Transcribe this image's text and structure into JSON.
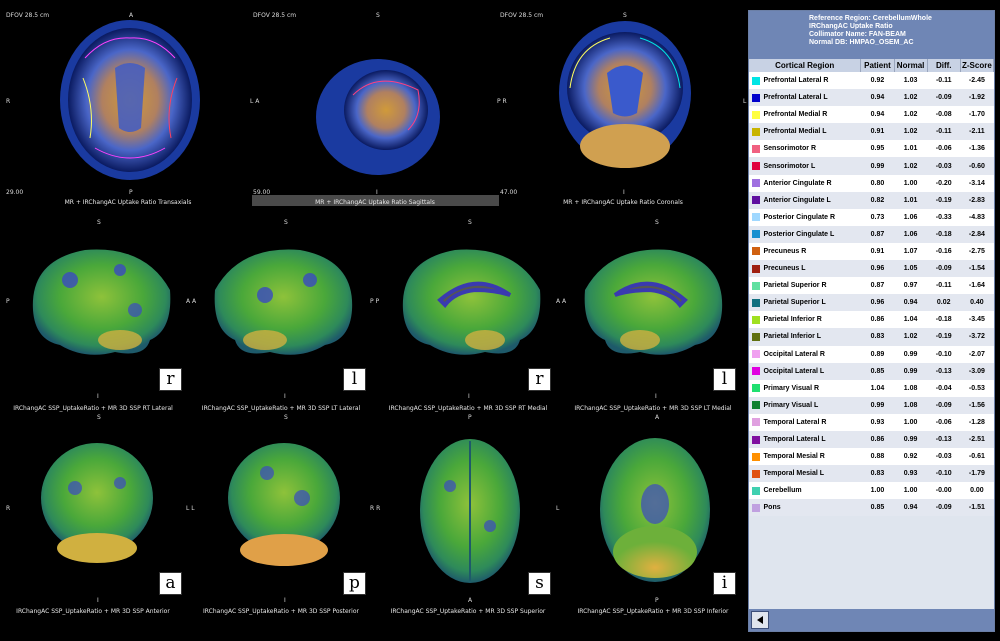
{
  "top": {
    "dfov_1": "DFOV 28.5 cm",
    "dfov_2": "DFOV 28.5 cm",
    "dfov_3": "DFOV 28.5 cm",
    "orient_1_top": "A",
    "orient_1_left": "R",
    "orient_1_bottom": "P",
    "orient_1_num": "29.00",
    "orient_2_top": "S",
    "orient_2_left": "L A",
    "orient_2_bottom": "I",
    "orient_2_num": "59.00",
    "orient_3_top": "S",
    "orient_3_left": "P R",
    "orient_3_right": "L",
    "orient_3_bottom": "I",
    "orient_3_num": "47.00",
    "caption_1": "MR + IRChangAC Uptake Ratio Transaxials",
    "caption_2": "MR + IRChangAC Uptake Ratio Sagittals",
    "caption_3": "MR + IRChangAC Uptake Ratio Coronals"
  },
  "mid": {
    "tops": [
      "S",
      "S",
      "S",
      "S"
    ],
    "lefts": [
      "P",
      "A A",
      "P P",
      "A A"
    ],
    "bottoms": [
      "I",
      "I",
      "I",
      "I"
    ],
    "badges": [
      "r",
      "l",
      "r",
      "l"
    ],
    "captions": [
      "IRChangAC SSP_UptakeRatio + MR 3D SSP RT Lateral",
      "IRChangAC SSP_UptakeRatio + MR 3D SSP LT Lateral",
      "IRChangAC SSP_UptakeRatio + MR 3D SSP RT Medial",
      "IRChangAC SSP_UptakeRatio + MR 3D SSP LT Medial"
    ]
  },
  "bot": {
    "tops": [
      "S",
      "S",
      "P",
      "A"
    ],
    "lefts": [
      "R",
      "L L",
      "R R",
      "L"
    ],
    "bottoms": [
      "I",
      "I",
      "A",
      "P"
    ],
    "badges": [
      "a",
      "p",
      "s",
      "i"
    ],
    "captions": [
      "IRChangAC SSP_UptakeRatio + MR 3D SSP Anterior",
      "IRChangAC SSP_UptakeRatio + MR 3D SSP Posterior",
      "IRChangAC SSP_UptakeRatio + MR 3D SSP Superior",
      "IRChangAC SSP_UptakeRatio + MR 3D SSP Inferior"
    ]
  },
  "panel": {
    "header": [
      "Reference Region: CerebellumWhole",
      "IRChangAC Uptake Ratio",
      "Collimator Name: FAN-BEAM",
      "Normal DB: HMPAO_OSEM_AC"
    ],
    "columns": [
      "Cortical Region",
      "Patient",
      "Normal",
      "Diff.",
      "Z-Score"
    ],
    "rows": [
      {
        "color": "#00e5e5",
        "name": "Prefrontal Lateral R",
        "patient": "0.92",
        "normal": "1.03",
        "diff": "-0.11",
        "z": "-2.45"
      },
      {
        "color": "#0000cc",
        "name": "Prefrontal Lateral L",
        "patient": "0.94",
        "normal": "1.02",
        "diff": "-0.09",
        "z": "-1.92"
      },
      {
        "color": "#ffff40",
        "name": "Prefrontal Medial R",
        "patient": "0.94",
        "normal": "1.02",
        "diff": "-0.08",
        "z": "-1.70"
      },
      {
        "color": "#c8b400",
        "name": "Prefrontal Medial L",
        "patient": "0.91",
        "normal": "1.02",
        "diff": "-0.11",
        "z": "-2.11"
      },
      {
        "color": "#f06080",
        "name": "Sensorimotor R",
        "patient": "0.95",
        "normal": "1.01",
        "diff": "-0.06",
        "z": "-1.36"
      },
      {
        "color": "#e0003c",
        "name": "Sensorimotor L",
        "patient": "0.99",
        "normal": "1.02",
        "diff": "-0.03",
        "z": "-0.60"
      },
      {
        "color": "#a070e0",
        "name": "Anterior Cingulate R",
        "patient": "0.80",
        "normal": "1.00",
        "diff": "-0.20",
        "z": "-3.14"
      },
      {
        "color": "#6010a0",
        "name": "Anterior Cingulate L",
        "patient": "0.82",
        "normal": "1.01",
        "diff": "-0.19",
        "z": "-2.83"
      },
      {
        "color": "#a0d8ff",
        "name": "Posterior Cingulate R",
        "patient": "0.73",
        "normal": "1.06",
        "diff": "-0.33",
        "z": "-4.83"
      },
      {
        "color": "#1890d0",
        "name": "Posterior Cingulate L",
        "patient": "0.87",
        "normal": "1.06",
        "diff": "-0.18",
        "z": "-2.84"
      },
      {
        "color": "#d06010",
        "name": "Precuneus R",
        "patient": "0.91",
        "normal": "1.07",
        "diff": "-0.16",
        "z": "-2.75"
      },
      {
        "color": "#a02010",
        "name": "Precuneus L",
        "patient": "0.96",
        "normal": "1.05",
        "diff": "-0.09",
        "z": "-1.54"
      },
      {
        "color": "#60e0a0",
        "name": "Parietal Superior R",
        "patient": "0.87",
        "normal": "0.97",
        "diff": "-0.11",
        "z": "-1.64"
      },
      {
        "color": "#107080",
        "name": "Parietal Superior L",
        "patient": "0.96",
        "normal": "0.94",
        "diff": "0.02",
        "z": "0.40"
      },
      {
        "color": "#a0e020",
        "name": "Parietal Inferior R",
        "patient": "0.86",
        "normal": "1.04",
        "diff": "-0.18",
        "z": "-3.45"
      },
      {
        "color": "#607010",
        "name": "Parietal Inferior L",
        "patient": "0.83",
        "normal": "1.02",
        "diff": "-0.19",
        "z": "-3.72"
      },
      {
        "color": "#f0a0f0",
        "name": "Occipital Lateral R",
        "patient": "0.89",
        "normal": "0.99",
        "diff": "-0.10",
        "z": "-2.07"
      },
      {
        "color": "#e000e0",
        "name": "Occipital Lateral L",
        "patient": "0.85",
        "normal": "0.99",
        "diff": "-0.13",
        "z": "-3.09"
      },
      {
        "color": "#20e070",
        "name": "Primary Visual R",
        "patient": "1.04",
        "normal": "1.08",
        "diff": "-0.04",
        "z": "-0.53"
      },
      {
        "color": "#108030",
        "name": "Primary Visual L",
        "patient": "0.99",
        "normal": "1.08",
        "diff": "-0.09",
        "z": "-1.56"
      },
      {
        "color": "#e0a0e0",
        "name": "Temporal Lateral R",
        "patient": "0.93",
        "normal": "1.00",
        "diff": "-0.06",
        "z": "-1.28"
      },
      {
        "color": "#8010a0",
        "name": "Temporal Lateral L",
        "patient": "0.86",
        "normal": "0.99",
        "diff": "-0.13",
        "z": "-2.51"
      },
      {
        "color": "#ff9000",
        "name": "Temporal Mesial R",
        "patient": "0.88",
        "normal": "0.92",
        "diff": "-0.03",
        "z": "-0.61"
      },
      {
        "color": "#e05010",
        "name": "Temporal Mesial L",
        "patient": "0.83",
        "normal": "0.93",
        "diff": "-0.10",
        "z": "-1.79"
      },
      {
        "color": "#40d0b0",
        "name": "Cerebellum",
        "patient": "1.00",
        "normal": "1.00",
        "diff": "-0.00",
        "z": "0.00"
      },
      {
        "color": "#c0a0e0",
        "name": "Pons",
        "patient": "0.85",
        "normal": "0.94",
        "diff": "-0.09",
        "z": "-1.51"
      }
    ]
  }
}
